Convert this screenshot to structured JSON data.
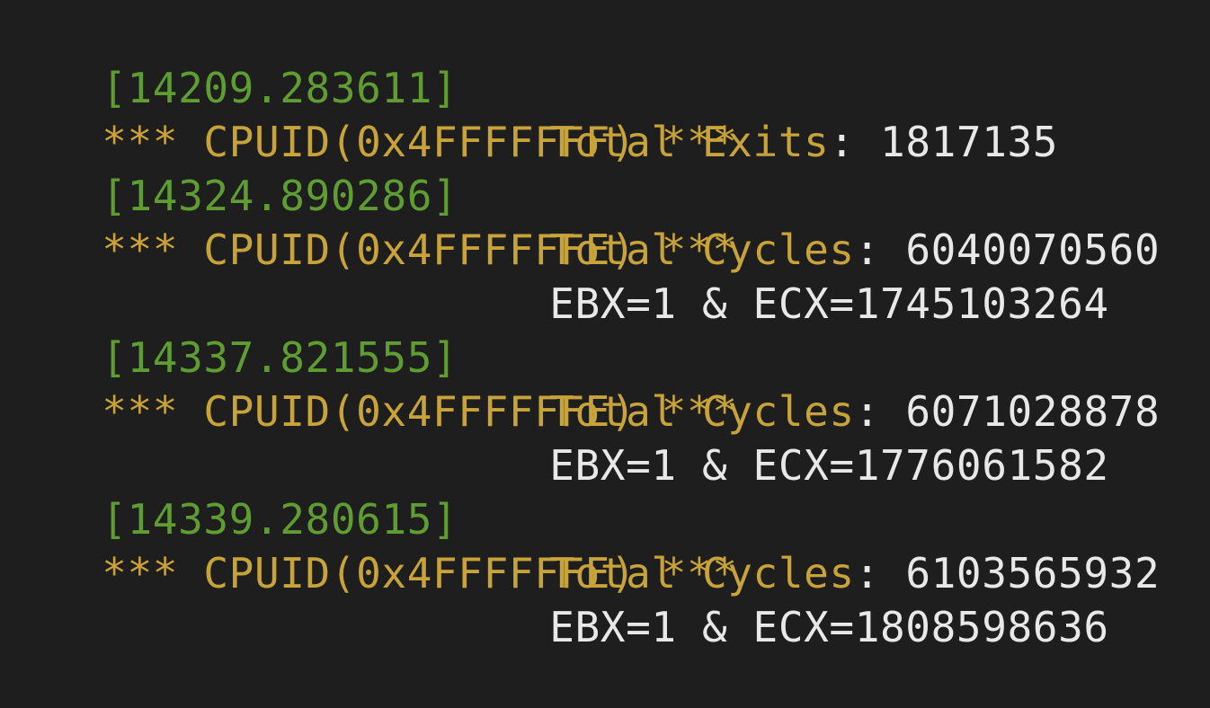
{
  "terminal": {
    "entries": [
      {
        "timestamp": "[14209.283611]",
        "header": "*** CPUID(0x4FFFFFFF) ***",
        "lines": [
          {
            "key": "Total Exits",
            "sep": ": ",
            "value": "1817135"
          }
        ]
      },
      {
        "timestamp": "[14324.890286]",
        "header": "*** CPUID(0x4FFFFFFE) ***",
        "lines": [
          {
            "key": "Total Cycles",
            "sep": ": ",
            "value": "6040070560"
          },
          {
            "text": "EBX=1 & ECX=1745103264"
          }
        ]
      },
      {
        "timestamp": "[14337.821555]",
        "header": "*** CPUID(0x4FFFFFFE) ***",
        "lines": [
          {
            "key": "Total Cycles",
            "sep": ": ",
            "value": "6071028878"
          },
          {
            "text": "EBX=1 & ECX=1776061582"
          }
        ]
      },
      {
        "timestamp": "[14339.280615]",
        "header": "*** CPUID(0x4FFFFFFE) ***",
        "lines": [
          {
            "key": "Total Cycles",
            "sep": ": ",
            "value": "6103565932"
          },
          {
            "text": "EBX=1 & ECX=1808598636"
          }
        ]
      }
    ]
  },
  "colors": {
    "background": "#1e1e1e",
    "timestamp": "#5f9d32",
    "header": "#c8a33a",
    "value": "#e8e8e8"
  }
}
